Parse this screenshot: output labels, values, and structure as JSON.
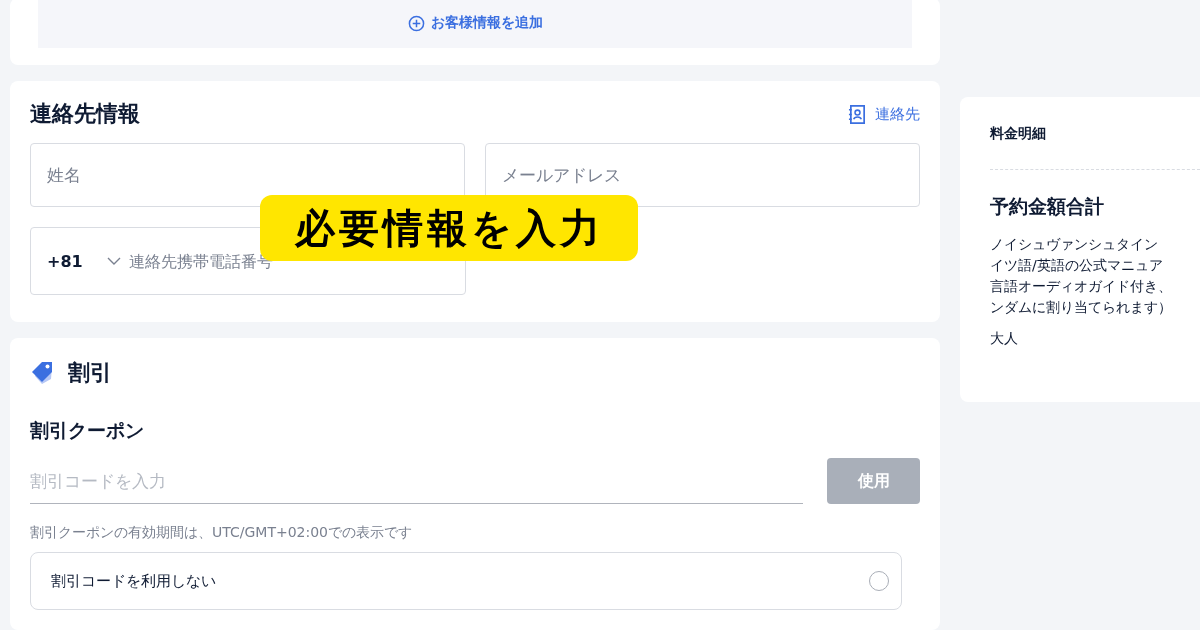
{
  "add_customer": {
    "label": "お客様情報を追加"
  },
  "contact": {
    "title": "連絡先情報",
    "contacts_link": "連絡先",
    "name_field": {
      "placeholder": "姓名"
    },
    "email_field": {
      "placeholder": "メールアドレス"
    },
    "phone": {
      "country_code": "+81",
      "placeholder": "連絡先携帯電話番号"
    }
  },
  "overlay_caption": "必要情報を入力",
  "discount": {
    "title": "割引",
    "coupon_title": "割引クーポン",
    "code_field": {
      "placeholder": "割引コードを入力"
    },
    "apply_button": {
      "label": "使用",
      "disabled": true
    },
    "note": "割引クーポンの有効期間は、UTC/GMT+02:00での表示です",
    "options": [
      {
        "label": "割引コードを利用しない",
        "selected": false
      }
    ]
  },
  "price_details": {
    "title": "料金明細",
    "total_title": "予約金額合計",
    "description_lines": [
      "ノイシュヴァンシュタイン",
      "イツ語/英語の公式マニュア",
      "言語オーディオガイド付き、",
      "ンダムに割り当てられます）"
    ],
    "ticket_type": "大人"
  }
}
